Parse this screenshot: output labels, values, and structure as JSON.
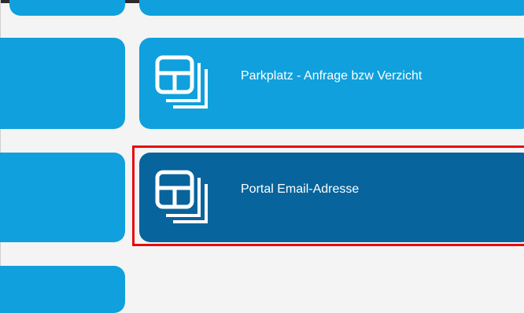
{
  "tiles": [
    {
      "title": ""
    },
    {
      "title": ""
    },
    {
      "title": "Parkplatz - Anfrage bzw Verzicht",
      "icon": "app-tile-icon"
    },
    {
      "title": ""
    },
    {
      "title": "Portal Email-Adresse",
      "icon": "app-tile-icon",
      "selected": true
    },
    {
      "title": ""
    }
  ],
  "colors": {
    "tile": "#0fa0dd",
    "tile_selected": "#07649c",
    "highlight": "#e8090e",
    "background": "#f4f4f4"
  }
}
